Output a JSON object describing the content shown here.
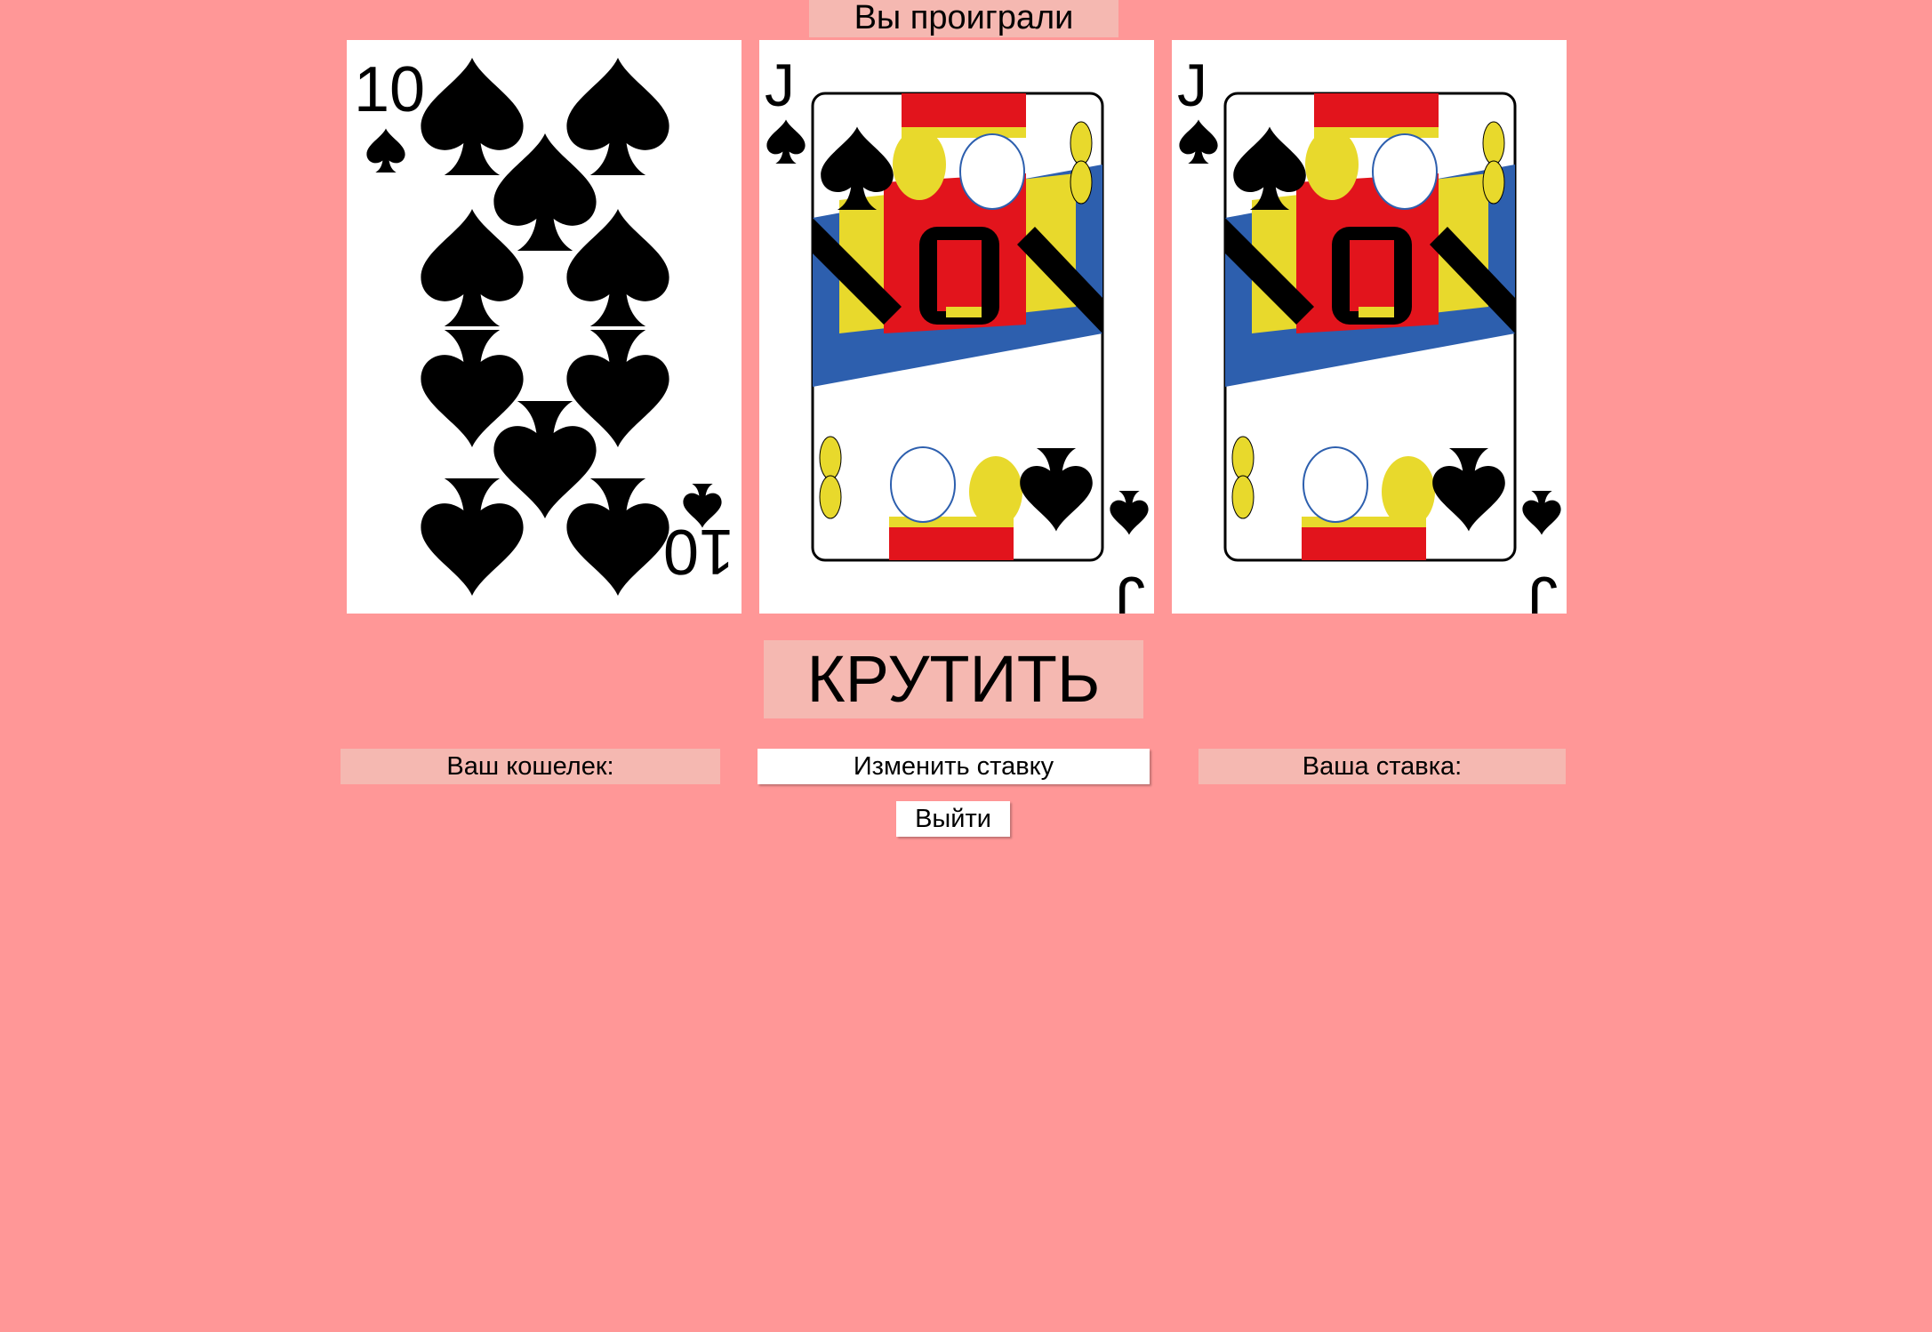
{
  "result": {
    "text": "Вы проиграли"
  },
  "cards": [
    {
      "rank": "10",
      "suit": "spades",
      "icon": "ten-of-spades-card"
    },
    {
      "rank": "J",
      "suit": "spades",
      "icon": "jack-of-spades-card"
    },
    {
      "rank": "J",
      "suit": "spades",
      "icon": "jack-of-spades-card"
    }
  ],
  "controls": {
    "spin_label": "КРУТИТЬ",
    "wallet_label": "Ваш кошелек:",
    "change_bet_label": "Изменить ставку",
    "bet_label": "Ваша ставка:",
    "exit_label": "Выйти"
  },
  "colors": {
    "background": "#ff9797",
    "panel": "#f5b8b1",
    "jack_red": "#e2141c",
    "jack_yellow": "#e8d92c",
    "jack_blue": "#2d5fae"
  }
}
